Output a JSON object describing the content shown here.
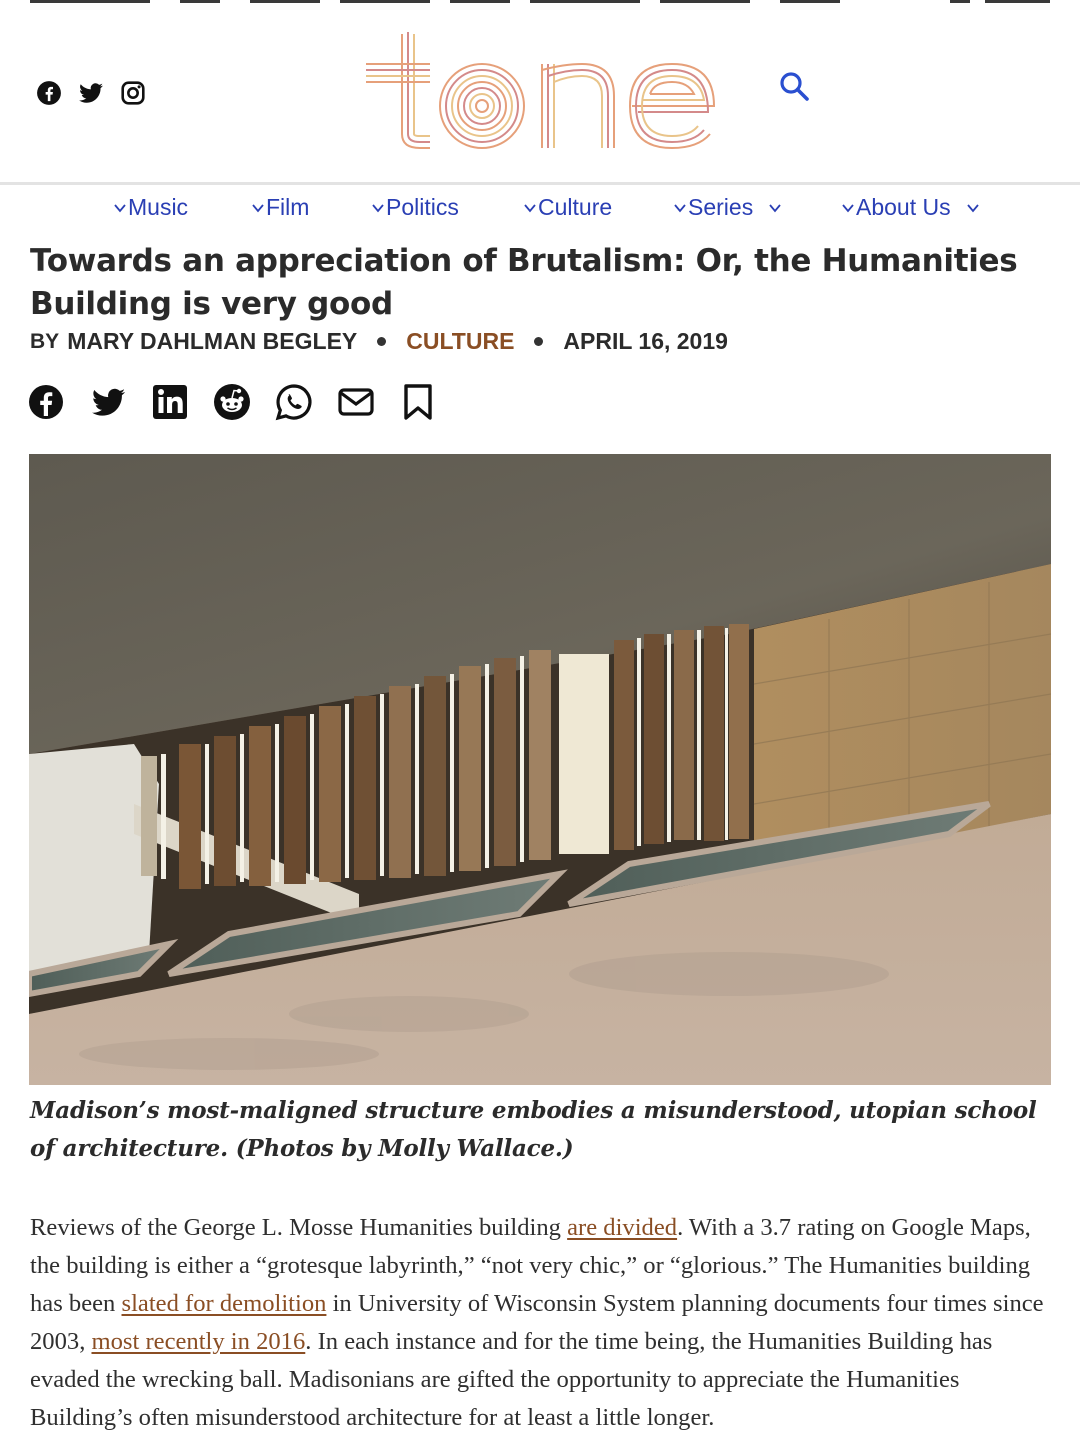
{
  "site": {
    "logo_text": "tone",
    "social": [
      "facebook-icon",
      "twitter-icon",
      "instagram-icon"
    ],
    "search_icon": "search-icon"
  },
  "nav": {
    "items": [
      {
        "label": "Music",
        "has_dropdown": false
      },
      {
        "label": "Film",
        "has_dropdown": false
      },
      {
        "label": "Politics",
        "has_dropdown": false
      },
      {
        "label": "Culture",
        "has_dropdown": false
      },
      {
        "label": "Series",
        "has_dropdown": true
      },
      {
        "label": "About Us",
        "has_dropdown": true
      }
    ]
  },
  "article": {
    "title": "Towards an appreciation of Brutalism: Or, the Humanities Building is very good",
    "byline_prefix": "BY",
    "author": "MARY DAHLMAN BEGLEY",
    "category": "CULTURE",
    "date": "APRIL 16, 2019",
    "share_icons": [
      "facebook-icon",
      "twitter-icon",
      "linkedin-icon",
      "reddit-icon",
      "whatsapp-icon",
      "email-icon",
      "bookmark-icon"
    ],
    "caption": "Madison’s most-maligned structure embodies a misunderstood, utopian school of architecture. (Photos by Molly Wallace.)",
    "body": {
      "p1_a": "Reviews of the George L. Mosse Humanities building ",
      "link1": "are divided",
      "p1_b": ". With a 3.7 rating on Google Maps, the building is either a “grotesque labyrinth,” “not very chic,” or “glorious.” The Humanities building has been ",
      "link2": "slated for demolition",
      "p1_c": " in University of Wisconsin System planning documents four times since 2003, ",
      "link3": "most recently in 2016",
      "p1_d": ". In each instance and for the time being, the Humanities Building has evaded the wrecking ball. Madisonians are gifted the opportunity to appreciate the Humanities Building’s often misunderstood architecture for at least a little longer."
    }
  },
  "colors": {
    "nav_blue": "#2a3fb4",
    "link_brown": "#8a4e24",
    "text_dark": "#2b2b2b"
  }
}
